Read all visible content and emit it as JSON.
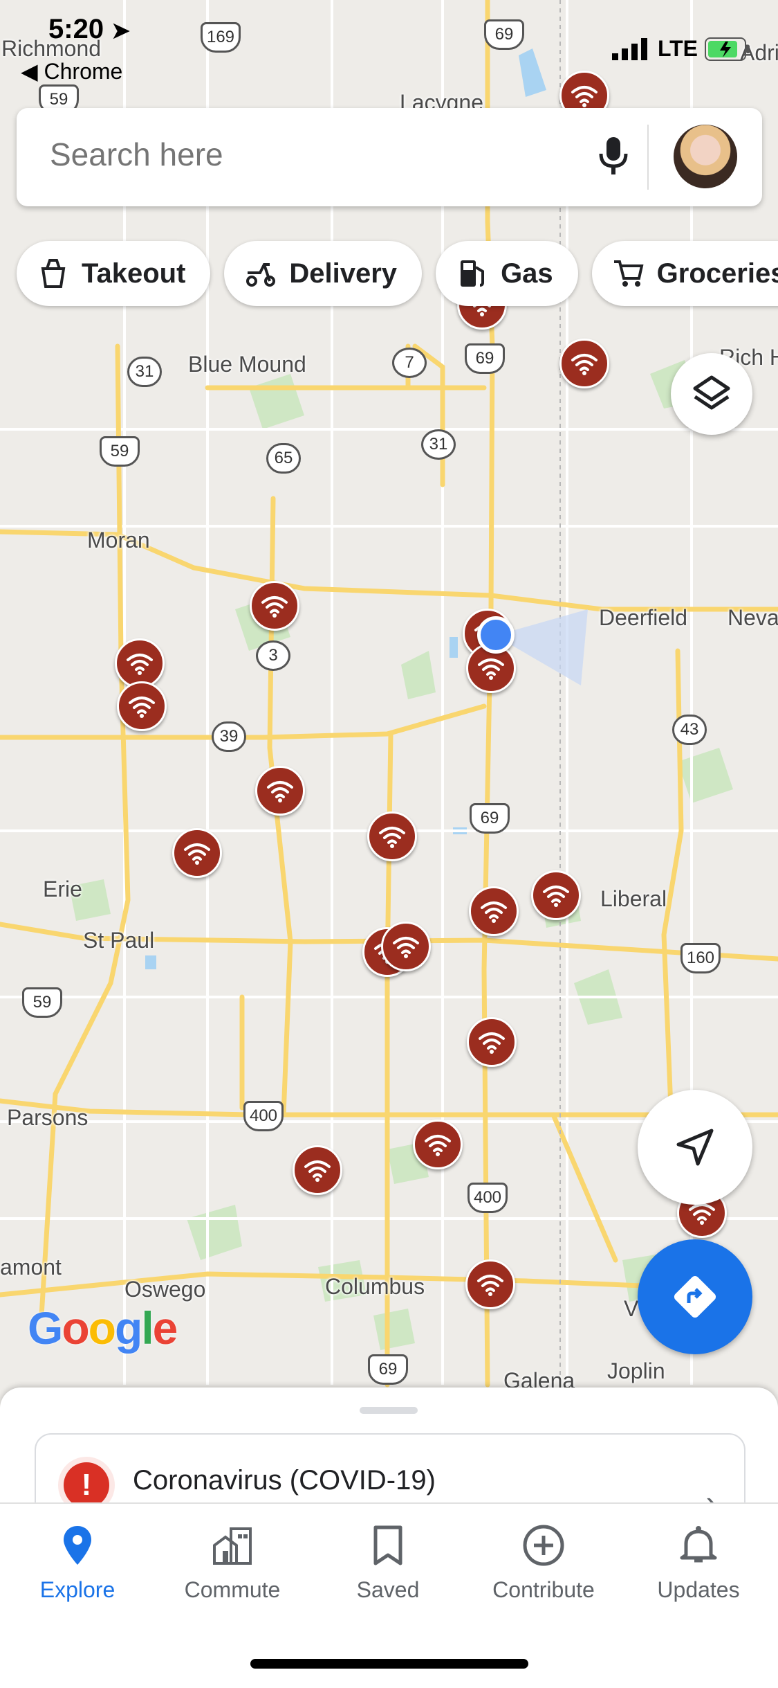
{
  "status_bar": {
    "time": "5:20",
    "back_app": "Chrome",
    "carrier": "LTE"
  },
  "search": {
    "placeholder": "Search here"
  },
  "chips": [
    {
      "label": "Takeout",
      "icon": "takeout-icon"
    },
    {
      "label": "Delivery",
      "icon": "scooter-icon"
    },
    {
      "label": "Gas",
      "icon": "gas-pump-icon"
    },
    {
      "label": "Groceries",
      "icon": "cart-icon"
    }
  ],
  "map": {
    "places": [
      "Richmond",
      "Lacygne",
      "Adri",
      "Blue Mound",
      "Rich H",
      "Moran",
      "Deerfield",
      "Neva",
      "Erie",
      "St Paul",
      "Liberal",
      "Parsons",
      "amont",
      "Oswego",
      "Columbus",
      "Galena",
      "Joplin",
      "V"
    ],
    "shields": [
      "169",
      "69",
      "59",
      "31",
      "7",
      "69",
      "59",
      "65",
      "31",
      "3",
      "39",
      "43",
      "69",
      "160",
      "59",
      "400",
      "400",
      "69"
    ],
    "pin_icon": "wifi-icon",
    "accent": "#9b2d1f",
    "location_dot_color": "#4285f4"
  },
  "google_logo": "Google",
  "sheet": {
    "card_title": "Coronavirus (COVID-19)"
  },
  "nav": [
    {
      "label": "Explore",
      "icon": "explore-pin-icon",
      "active": true
    },
    {
      "label": "Commute",
      "icon": "commute-icon",
      "active": false
    },
    {
      "label": "Saved",
      "icon": "bookmark-icon",
      "active": false
    },
    {
      "label": "Contribute",
      "icon": "plus-circle-icon",
      "active": false
    },
    {
      "label": "Updates",
      "icon": "bell-icon",
      "active": false
    }
  ]
}
